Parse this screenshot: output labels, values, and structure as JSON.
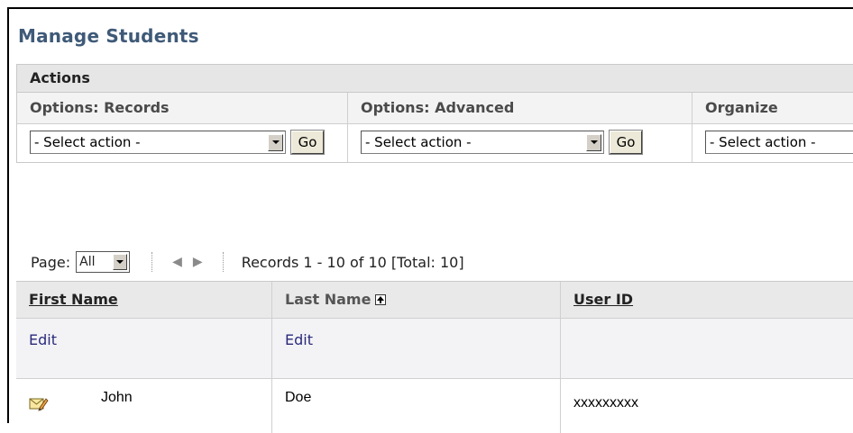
{
  "page": {
    "title": "Manage Students"
  },
  "actions": {
    "header": "Actions",
    "columns": [
      {
        "label": "Options: Records",
        "select_value": "- Select action -",
        "go_label": "Go"
      },
      {
        "label": "Options: Advanced",
        "select_value": "- Select action -",
        "go_label": "Go"
      },
      {
        "label": "Organize",
        "select_value": "- Select action -"
      }
    ]
  },
  "pager": {
    "label": "Page:",
    "selected": "All",
    "prev": "◀",
    "next": "▶",
    "records_text": "Records 1 - 10 of 10 [Total: 10]"
  },
  "grid": {
    "headers": [
      "First Name",
      "Last Name",
      "User ID"
    ],
    "edit_labels": [
      "Edit",
      "Edit"
    ],
    "rows": [
      {
        "first_name": "John",
        "last_name": "Doe",
        "user_id": "xxxxxxxxx"
      }
    ]
  },
  "icons": {
    "sort": "sort-ascending-icon",
    "row": "mail-edit-icon"
  },
  "colors": {
    "title": "#3f5a78",
    "link": "#2a2a7a",
    "header_bg": "#e6e6e6"
  }
}
